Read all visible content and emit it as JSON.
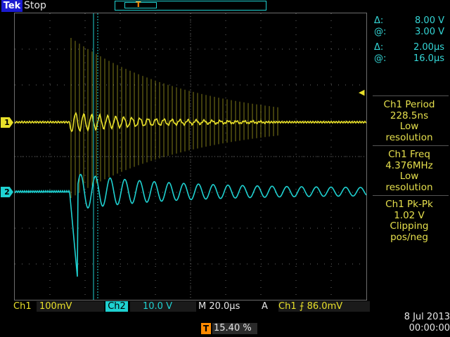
{
  "header": {
    "brand": "Tek",
    "status": "Stop"
  },
  "channels": {
    "ch1_marker": "1",
    "ch2_marker": "2",
    "trigger_marker": "T"
  },
  "cursors": {
    "v_delta_label": "Δ:",
    "v_delta_value": "8.00 V",
    "v_at_label": "@:",
    "v_at_value": "3.00 V",
    "t_delta_label": "Δ:",
    "t_delta_value": "2.00μs",
    "t_at_label": "@:",
    "t_at_value": "16.0μs"
  },
  "measurements": [
    {
      "lines": [
        "Ch1 Period",
        "228.5ns",
        "Low",
        "resolution"
      ]
    },
    {
      "lines": [
        "Ch1 Freq",
        "4.376MHz",
        "Low",
        "resolution"
      ]
    },
    {
      "lines": [
        "Ch1 Pk-Pk",
        "1.02 V",
        "Clipping",
        "pos/neg"
      ]
    }
  ],
  "bottom_bar": {
    "ch1_label": "Ch1",
    "ch1_scale": "100mV",
    "ch2_label": "Ch2",
    "ch2_scale": "10.0 V",
    "timebase": "M 20.0μs",
    "acq": "A",
    "trigger": "Ch1  ⨍  86.0mV"
  },
  "date": {
    "day": "8 Jul  2013",
    "time": "00:00:00"
  },
  "trigger_position": {
    "icon": "T",
    "value": "15.40 %"
  },
  "colors": {
    "ch1": "#e8e02a",
    "ch2": "#1fd1d1",
    "grid": "#6d6d6d",
    "trigger": "#ff8a00"
  }
}
